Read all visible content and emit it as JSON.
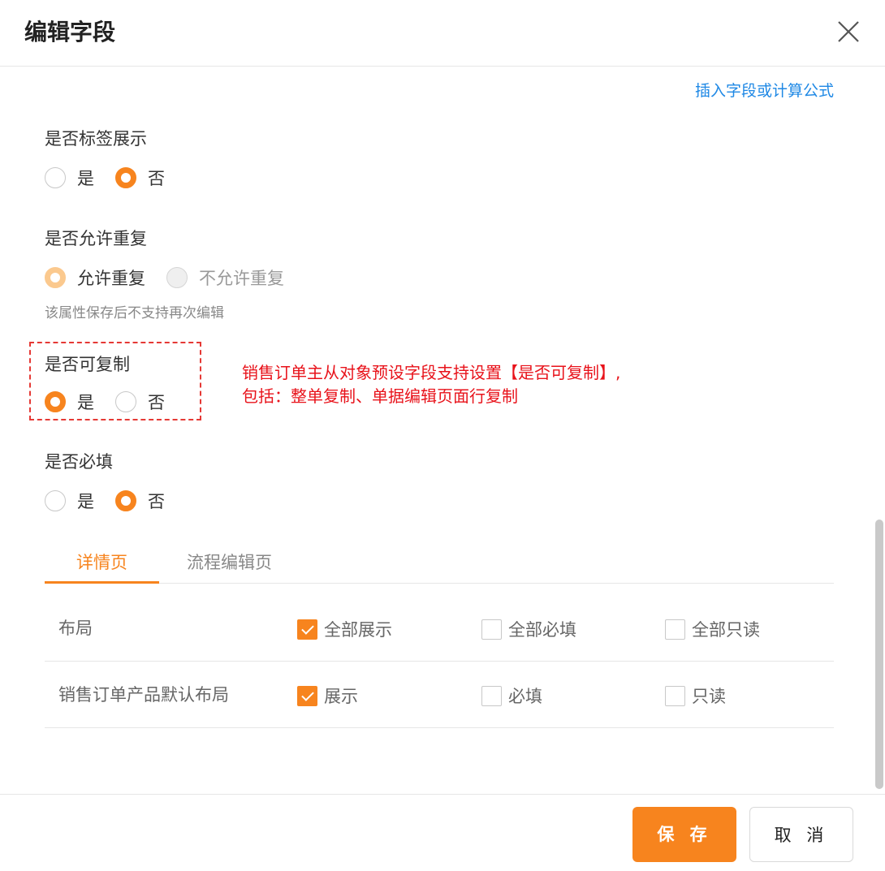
{
  "dialog": {
    "title": "编辑字段"
  },
  "formula": {
    "insert_link": "插入字段或计算公式"
  },
  "label_display": {
    "label": "是否标签展示",
    "options": [
      {
        "label": "是",
        "selected": false
      },
      {
        "label": "否",
        "selected": true
      }
    ]
  },
  "allow_duplicate": {
    "label": "是否允许重复",
    "options": [
      {
        "label": "允许重复",
        "selected": true
      },
      {
        "label": "不允许重复",
        "selected": false
      }
    ],
    "hint": "该属性保存后不支持再次编辑"
  },
  "copyable": {
    "label": "是否可复制",
    "options": [
      {
        "label": "是",
        "selected": true
      },
      {
        "label": "否",
        "selected": false
      }
    ]
  },
  "annotation": {
    "line1": "销售订单主从对象预设字段支持设置【是否可复制】,",
    "line2": "包括：整单复制、单据编辑页面行复制"
  },
  "required": {
    "label": "是否必填",
    "options": [
      {
        "label": "是",
        "selected": false
      },
      {
        "label": "否",
        "selected": true
      }
    ]
  },
  "tabs": [
    {
      "label": "详情页",
      "active": true
    },
    {
      "label": "流程编辑页",
      "active": false
    }
  ],
  "layout_table": {
    "rows": [
      {
        "name": "布局",
        "show": {
          "label": "全部展示",
          "checked": true
        },
        "required": {
          "label": "全部必填",
          "checked": false
        },
        "readonly": {
          "label": "全部只读",
          "checked": false
        }
      },
      {
        "name": "销售订单产品默认布局",
        "show": {
          "label": "展示",
          "checked": true
        },
        "required": {
          "label": "必填",
          "checked": false
        },
        "readonly": {
          "label": "只读",
          "checked": false
        }
      }
    ]
  },
  "footer": {
    "save_label": "保 存",
    "cancel_label": "取 消"
  },
  "colors": {
    "accent": "#f7841e",
    "link": "#1e88e5",
    "annotation": "#e8121a"
  },
  "icons": {
    "close": "close-icon",
    "check": "check-icon"
  }
}
